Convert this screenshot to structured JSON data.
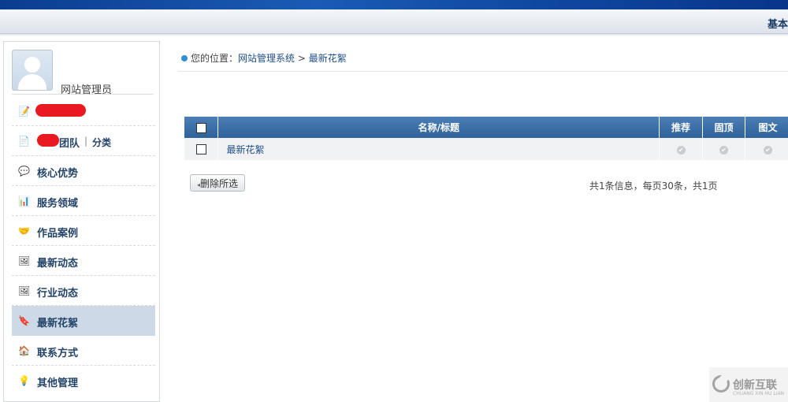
{
  "header": {
    "right_title": "基本"
  },
  "user": {
    "name": "网站管理员"
  },
  "sidebar": {
    "items": [
      {
        "label": "",
        "icon": "edit-icon"
      },
      {
        "label": "团队",
        "sub": "分类",
        "icon": "document-icon"
      },
      {
        "label": "核心优势",
        "icon": "chat-icon"
      },
      {
        "label": "服务领域",
        "icon": "bar-chart-icon"
      },
      {
        "label": "作品案例",
        "icon": "handshake-icon"
      },
      {
        "label": "最新动态",
        "icon": "image-icon"
      },
      {
        "label": "行业动态",
        "icon": "image-icon"
      },
      {
        "label": "最新花絮",
        "icon": "bookmark-icon",
        "active": true
      },
      {
        "label": "联系方式",
        "icon": "house-icon"
      },
      {
        "label": "其他管理",
        "icon": "lightbulb-icon"
      }
    ]
  },
  "breadcrumb": {
    "prefix": "您的位置：",
    "root": "网站管理系统",
    "sep": ">",
    "current": "最新花絮"
  },
  "table": {
    "columns": [
      "名称/标题",
      "推荐",
      "固顶",
      "图文"
    ],
    "rows": [
      {
        "title": "最新花絮"
      }
    ]
  },
  "actions": {
    "delete_selected": "删除所选"
  },
  "pagination": {
    "info": "共1条信息，每页30条，共1页"
  },
  "watermark": {
    "cn": "创新互联",
    "en": "CHUANG XIN HU LIAN"
  },
  "colors": {
    "accent": "#2e6198",
    "active_bg": "#cdd9e6",
    "link": "#1f4f86"
  }
}
